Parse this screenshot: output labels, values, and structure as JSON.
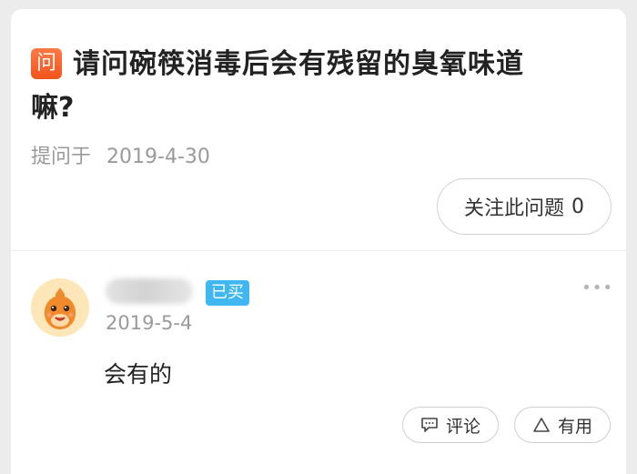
{
  "question": {
    "badge_char": "问",
    "title_line1": "请问碗筷消毒后会有残留的臭氧味道",
    "title_line2": "嘛?",
    "asked_label": "提问于",
    "asked_date": "2019-4-30",
    "follow_label": "关注此问题",
    "follow_count": "0"
  },
  "answer": {
    "bought_badge": "已买",
    "date": "2019-5-4",
    "text": "会有的",
    "more_glyph": "•••",
    "comment_label": "评论",
    "useful_label": "有用"
  },
  "icons": {
    "question_badge": "question-icon",
    "more": "more-dots-icon",
    "comment": "comment-bubble-icon",
    "useful": "triangle-up-icon"
  },
  "colors": {
    "question_badge": "#f2531c",
    "bought_badge": "#3fb7f0"
  }
}
